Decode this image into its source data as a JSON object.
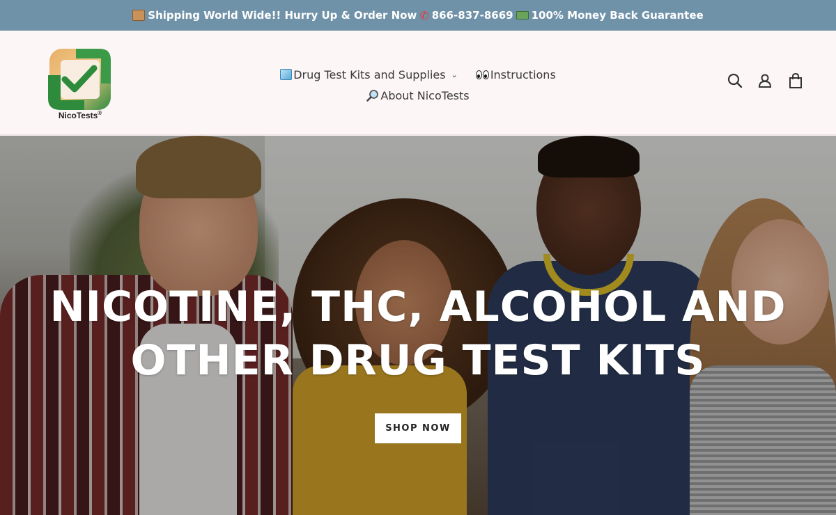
{
  "announcement": {
    "part1": "Shipping World Wide!! Hurry Up & Order Now",
    "phone": "866-837-8669",
    "part3": "100% Money Back Guarantee"
  },
  "logo": {
    "text": "NicoTests",
    "registered": "®"
  },
  "nav": {
    "items": [
      {
        "label": "Drug Test Kits and Supplies",
        "icon": "cube-icon",
        "has_dropdown": true
      },
      {
        "label": "Instructions",
        "icon": "eyes-icon"
      },
      {
        "label": "About NicoTests",
        "icon": "magnifier-icon"
      }
    ]
  },
  "header_icons": [
    "search-icon",
    "account-icon",
    "cart-icon"
  ],
  "hero": {
    "title_line1": "NICOTINE, THC, ALCOHOL AND",
    "title_line2": "OTHER DRUG TEST KITS",
    "button": "SHOP NOW"
  },
  "colors": {
    "announcement_bg": "#6f92a8",
    "header_bg": "#fdf6f6",
    "logo_green": "#2e8b3c",
    "logo_gold": "#e7b067"
  }
}
